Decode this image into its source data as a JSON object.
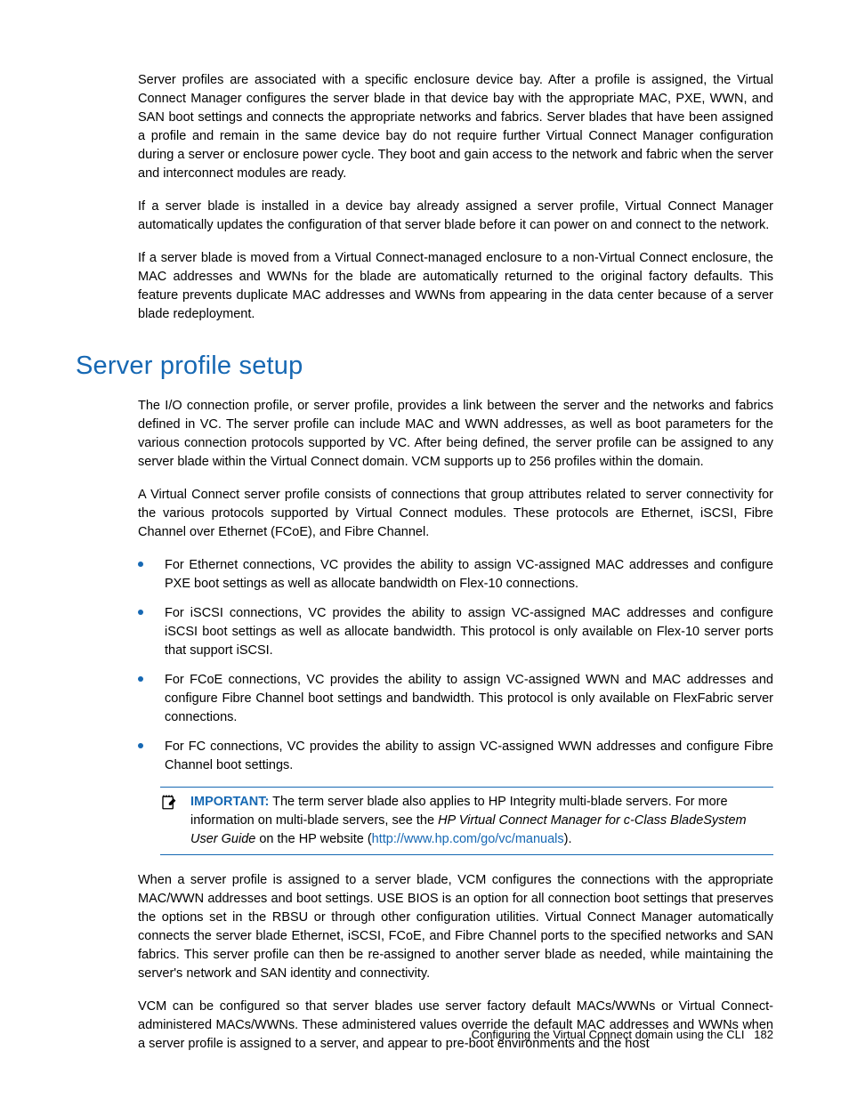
{
  "p1": "Server profiles are associated with a specific enclosure device bay. After a profile is assigned, the Virtual Connect Manager configures the server blade in that device bay with the appropriate MAC, PXE, WWN, and SAN boot settings and connects the appropriate networks and fabrics. Server blades that have been assigned a profile and remain in the same device bay do not require further Virtual Connect Manager configuration during a server or enclosure power cycle. They boot and gain access to the network and fabric when the server and interconnect modules are ready.",
  "p2": "If a server blade is installed in a device bay already assigned a server profile, Virtual Connect Manager automatically updates the configuration of that server blade before it can power on and connect to the network.",
  "p3": "If a server blade is moved from a Virtual Connect-managed enclosure to a non-Virtual Connect enclosure, the MAC addresses and WWNs for the blade are automatically returned to the original factory defaults. This feature prevents duplicate MAC addresses and WWNs from appearing in the data center because of a server blade redeployment.",
  "h2": "Server profile setup",
  "p4": "The I/O connection profile, or server profile, provides a link between the server and the networks and fabrics defined in VC. The server profile can include MAC and WWN addresses, as well as boot parameters for the various connection protocols supported by VC. After being defined, the server profile can be assigned to any server blade within the Virtual Connect domain. VCM supports up to 256 profiles within the domain.",
  "p5": "A Virtual Connect server profile consists of connections that group attributes related to server connectivity for the various protocols supported by Virtual Connect modules. These protocols are Ethernet, iSCSI, Fibre Channel over Ethernet (FCoE), and Fibre Channel.",
  "li1": "For Ethernet connections, VC provides the ability to assign VC-assigned MAC addresses and configure PXE boot settings as well as allocate bandwidth on Flex-10 connections.",
  "li2": "For iSCSI connections, VC provides the ability to assign VC-assigned MAC addresses and configure iSCSI boot settings as well as allocate bandwidth. This protocol is only available on Flex-10 server ports that support iSCSI.",
  "li3": "For FCoE connections, VC provides the ability to assign VC-assigned WWN and MAC addresses and configure Fibre Channel boot settings and bandwidth. This protocol is only available on FlexFabric server connections.",
  "li4": "For FC connections, VC provides the ability to assign VC-assigned WWN addresses and configure Fibre Channel boot settings.",
  "callout": {
    "label": "IMPORTANT:",
    "t1": " The term server blade also applies to HP Integrity multi-blade servers. For more information on multi-blade servers, see the ",
    "it": "HP Virtual Connect Manager for c-Class BladeSystem User Guide",
    "t2": " on the HP website (",
    "link": "http://www.hp.com/go/vc/manuals",
    "t3": ")."
  },
  "p6": "When a server profile is assigned to a server blade, VCM configures the connections with the appropriate MAC/WWN addresses and boot settings. USE BIOS is an option for all connection boot settings that preserves the options set in the RBSU or through other configuration utilities. Virtual Connect Manager automatically connects the server blade Ethernet, iSCSI, FCoE, and Fibre Channel ports to the specified networks and SAN fabrics. This server profile can then be re-assigned to another server blade as needed, while maintaining the server's network and SAN identity and connectivity.",
  "p7": "VCM can be configured so that server blades use server factory default MACs/WWNs or Virtual Connect-administered MACs/WWNs. These administered values override the default MAC addresses and WWNs when a server profile is assigned to a server, and appear to pre-boot environments and the host",
  "footer": {
    "text": "Configuring the Virtual Connect domain using the CLI",
    "page": "182"
  }
}
